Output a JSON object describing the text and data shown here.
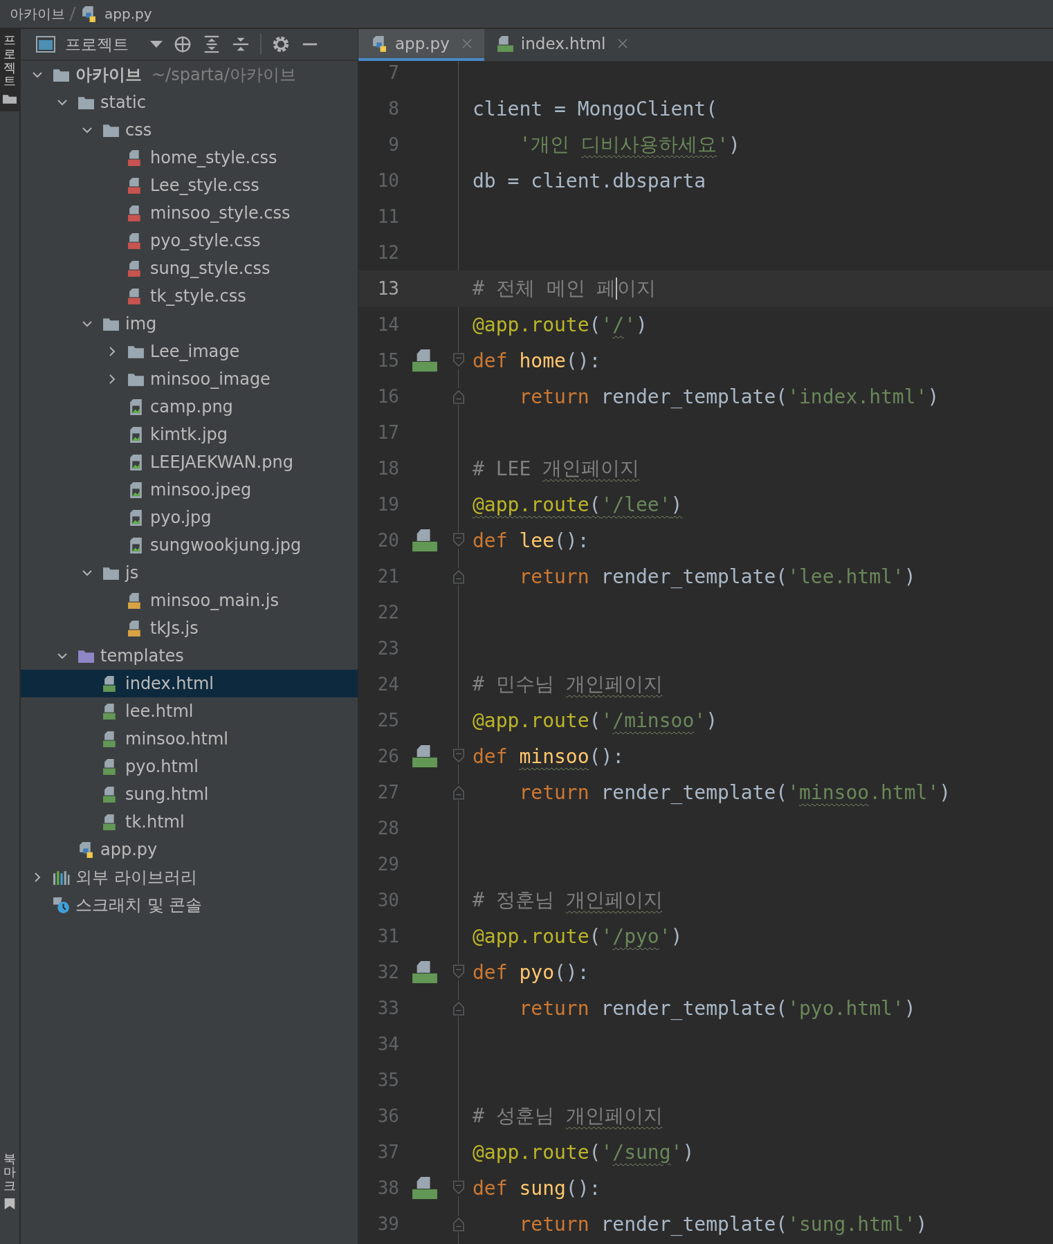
{
  "breadcrumb": [
    "아카이브",
    "app.py"
  ],
  "tool_strip": [
    {
      "label": "프로젝트",
      "selected": true,
      "kind": "project"
    },
    {
      "label": "북마크",
      "selected": false,
      "kind": "bookmarks"
    }
  ],
  "project_panel": {
    "title": "프로젝트",
    "tree": [
      {
        "label": "아카이브",
        "path": "~/sparta/아카이브",
        "kind": "folder",
        "expanded": true,
        "selected": false,
        "children": [
          {
            "label": "static",
            "kind": "folder",
            "expanded": true,
            "selected": false,
            "children": [
              {
                "label": "css",
                "kind": "folder",
                "expanded": true,
                "selected": false,
                "children": [
                  {
                    "label": "home_style.css",
                    "kind": "css",
                    "selected": false
                  },
                  {
                    "label": "Lee_style.css",
                    "kind": "css",
                    "selected": false
                  },
                  {
                    "label": "minsoo_style.css",
                    "kind": "css",
                    "selected": false
                  },
                  {
                    "label": "pyo_style.css",
                    "kind": "css",
                    "selected": false
                  },
                  {
                    "label": "sung_style.css",
                    "kind": "css",
                    "selected": false
                  },
                  {
                    "label": "tk_style.css",
                    "kind": "css",
                    "selected": false
                  }
                ]
              },
              {
                "label": "img",
                "kind": "folder",
                "expanded": true,
                "selected": false,
                "children": [
                  {
                    "label": "Lee_image",
                    "kind": "folder",
                    "expanded": false,
                    "selected": false
                  },
                  {
                    "label": "minsoo_image",
                    "kind": "folder",
                    "expanded": false,
                    "selected": false
                  },
                  {
                    "label": "camp.png",
                    "kind": "image",
                    "selected": false
                  },
                  {
                    "label": "kimtk.jpg",
                    "kind": "image",
                    "selected": false
                  },
                  {
                    "label": "LEEJAEKWAN.png",
                    "kind": "image",
                    "selected": false
                  },
                  {
                    "label": "minsoo.jpeg",
                    "kind": "image",
                    "selected": false
                  },
                  {
                    "label": "pyo.jpg",
                    "kind": "image",
                    "selected": false
                  },
                  {
                    "label": "sungwookjung.jpg",
                    "kind": "image",
                    "selected": false
                  }
                ]
              },
              {
                "label": "js",
                "kind": "folder",
                "expanded": true,
                "selected": false,
                "children": [
                  {
                    "label": "minsoo_main.js",
                    "kind": "js",
                    "selected": false
                  },
                  {
                    "label": "tkJs.js",
                    "kind": "js",
                    "selected": false
                  }
                ]
              }
            ]
          },
          {
            "label": "templates",
            "kind": "templates",
            "expanded": true,
            "selected": false,
            "children": [
              {
                "label": "index.html",
                "kind": "html",
                "selected": true
              },
              {
                "label": "lee.html",
                "kind": "html",
                "selected": false
              },
              {
                "label": "minsoo.html",
                "kind": "html",
                "selected": false
              },
              {
                "label": "pyo.html",
                "kind": "html",
                "selected": false
              },
              {
                "label": "sung.html",
                "kind": "html",
                "selected": false
              },
              {
                "label": "tk.html",
                "kind": "html",
                "selected": false
              }
            ]
          },
          {
            "label": "app.py",
            "kind": "python",
            "selected": false
          }
        ]
      },
      {
        "label": "외부 라이브러리",
        "kind": "library",
        "expanded": false,
        "selected": false
      },
      {
        "label": "스크래치 및 콘솔",
        "kind": "scratch",
        "selected": false
      }
    ]
  },
  "tabs": [
    {
      "label": "app.py",
      "kind": "python",
      "selected": true
    },
    {
      "label": "index.html",
      "kind": "html",
      "selected": false
    }
  ],
  "lines": [
    {
      "number": "7"
    },
    {
      "number": "8",
      "tokens": [
        {
          "text": "client = MongoClient(",
          "kind": "plain"
        }
      ]
    },
    {
      "number": "9",
      "indented": true,
      "tokens": [
        {
          "text": "'개인 ",
          "kind": "string"
        },
        {
          "text": "디비사용하세요",
          "kind": "string",
          "underlined": true
        },
        {
          "text": "'",
          "kind": "string"
        },
        {
          "text": ")",
          "kind": "plain"
        }
      ]
    },
    {
      "number": "10",
      "tokens": [
        {
          "text": "db = client.dbsparta",
          "kind": "plain"
        }
      ]
    },
    {
      "number": "11"
    },
    {
      "number": "12"
    },
    {
      "number": "13",
      "current": true,
      "tokens": [
        {
          "text": "# 전체 메인 페",
          "kind": "comment",
          "caret_after": true
        },
        {
          "text": "이지",
          "kind": "comment"
        }
      ]
    },
    {
      "number": "14",
      "tokens": [
        {
          "text": "@app.route",
          "kind": "decorator"
        },
        {
          "text": "(",
          "kind": "plain"
        },
        {
          "text": "'",
          "kind": "string"
        },
        {
          "text": "/",
          "kind": "string",
          "underlined": true
        },
        {
          "text": "'",
          "kind": "string"
        },
        {
          "text": ")",
          "kind": "plain"
        }
      ]
    },
    {
      "number": "15",
      "html_icon": true,
      "fold_start": true,
      "tokens": [
        {
          "text": "def",
          "kind": "keyword"
        },
        {
          "text": "home",
          "kind": "function",
          "space_before": true
        },
        {
          "text": "():",
          "kind": "plain"
        }
      ]
    },
    {
      "number": "16",
      "indented": true,
      "fold_end": true,
      "tokens": [
        {
          "text": "return",
          "kind": "keyword"
        },
        {
          "text": "render_template(",
          "kind": "plain",
          "space_before": true
        },
        {
          "text": "'index.html'",
          "kind": "string"
        },
        {
          "text": ")",
          "kind": "plain"
        }
      ]
    },
    {
      "number": "17"
    },
    {
      "number": "18",
      "tokens": [
        {
          "text": "# LEE ",
          "kind": "comment"
        },
        {
          "text": "개인페이지",
          "kind": "comment",
          "underlined": true
        }
      ]
    },
    {
      "number": "19",
      "tokens": [
        {
          "text": "@app.route",
          "kind": "decorator",
          "underlined": true
        },
        {
          "text": "(",
          "kind": "plain",
          "underlined": true
        },
        {
          "text": "'/lee'",
          "kind": "string",
          "underlined": true
        },
        {
          "text": ")",
          "kind": "plain",
          "underlined": true
        }
      ]
    },
    {
      "number": "20",
      "html_icon": true,
      "fold_start": true,
      "tokens": [
        {
          "text": "def",
          "kind": "keyword"
        },
        {
          "text": "lee",
          "kind": "function",
          "space_before": true
        },
        {
          "text": "():",
          "kind": "plain"
        }
      ]
    },
    {
      "number": "21",
      "indented": true,
      "fold_end": true,
      "tokens": [
        {
          "text": "return",
          "kind": "keyword"
        },
        {
          "text": "render_template(",
          "kind": "plain",
          "space_before": true
        },
        {
          "text": "'lee.html'",
          "kind": "string"
        },
        {
          "text": ")",
          "kind": "plain"
        }
      ]
    },
    {
      "number": "22"
    },
    {
      "number": "23"
    },
    {
      "number": "24",
      "tokens": [
        {
          "text": "# 민수님 ",
          "kind": "comment"
        },
        {
          "text": "개인페이지",
          "kind": "comment",
          "underlined": true
        }
      ]
    },
    {
      "number": "25",
      "tokens": [
        {
          "text": "@app.route",
          "kind": "decorator"
        },
        {
          "text": "(",
          "kind": "plain"
        },
        {
          "text": "'",
          "kind": "string"
        },
        {
          "text": "/minsoo",
          "kind": "string",
          "underlined": true
        },
        {
          "text": "'",
          "kind": "string"
        },
        {
          "text": ")",
          "kind": "plain"
        }
      ]
    },
    {
      "number": "26",
      "html_icon": true,
      "fold_start": true,
      "tokens": [
        {
          "text": "def",
          "kind": "keyword"
        },
        {
          "text": "minsoo",
          "kind": "function",
          "underlined": true,
          "space_before": true
        },
        {
          "text": "():",
          "kind": "plain"
        }
      ]
    },
    {
      "number": "27",
      "indented": true,
      "fold_end": true,
      "tokens": [
        {
          "text": "return",
          "kind": "keyword"
        },
        {
          "text": "render_template(",
          "kind": "plain",
          "space_before": true
        },
        {
          "text": "'",
          "kind": "string"
        },
        {
          "text": "minsoo",
          "kind": "string",
          "underlined": true
        },
        {
          "text": ".html'",
          "kind": "string"
        },
        {
          "text": ")",
          "kind": "plain"
        }
      ]
    },
    {
      "number": "28"
    },
    {
      "number": "29"
    },
    {
      "number": "30",
      "tokens": [
        {
          "text": "# 정훈님 ",
          "kind": "comment"
        },
        {
          "text": "개인페이지",
          "kind": "comment",
          "underlined": true
        }
      ]
    },
    {
      "number": "31",
      "tokens": [
        {
          "text": "@app.route",
          "kind": "decorator"
        },
        {
          "text": "(",
          "kind": "plain"
        },
        {
          "text": "'",
          "kind": "string"
        },
        {
          "text": "/pyo",
          "kind": "string",
          "underlined": true
        },
        {
          "text": "'",
          "kind": "string"
        },
        {
          "text": ")",
          "kind": "plain"
        }
      ]
    },
    {
      "number": "32",
      "html_icon": true,
      "fold_start": true,
      "tokens": [
        {
          "text": "def",
          "kind": "keyword"
        },
        {
          "text": "pyo",
          "kind": "function",
          "space_before": true
        },
        {
          "text": "():",
          "kind": "plain"
        }
      ]
    },
    {
      "number": "33",
      "indented": true,
      "fold_end": true,
      "tokens": [
        {
          "text": "return",
          "kind": "keyword"
        },
        {
          "text": "render_template(",
          "kind": "plain",
          "space_before": true
        },
        {
          "text": "'pyo.html'",
          "kind": "string"
        },
        {
          "text": ")",
          "kind": "plain"
        }
      ]
    },
    {
      "number": "34"
    },
    {
      "number": "35"
    },
    {
      "number": "36",
      "tokens": [
        {
          "text": "# 성훈님 ",
          "kind": "comment"
        },
        {
          "text": "개인페이지",
          "kind": "comment",
          "underlined": true
        }
      ]
    },
    {
      "number": "37",
      "tokens": [
        {
          "text": "@app.route",
          "kind": "decorator"
        },
        {
          "text": "(",
          "kind": "plain"
        },
        {
          "text": "'",
          "kind": "string"
        },
        {
          "text": "/sung",
          "kind": "string",
          "underlined": true
        },
        {
          "text": "'",
          "kind": "string"
        },
        {
          "text": ")",
          "kind": "plain"
        }
      ]
    },
    {
      "number": "38",
      "html_icon": true,
      "fold_start": true,
      "tokens": [
        {
          "text": "def",
          "kind": "keyword"
        },
        {
          "text": "sung",
          "kind": "function",
          "space_before": true
        },
        {
          "text": "():",
          "kind": "plain"
        }
      ]
    },
    {
      "number": "39",
      "indented": true,
      "fold_end": true,
      "tokens": [
        {
          "text": "return",
          "kind": "keyword"
        },
        {
          "text": "render_template(",
          "kind": "plain",
          "space_before": true
        },
        {
          "text": "'sung.html'",
          "kind": "string"
        },
        {
          "text": ")",
          "kind": "plain"
        }
      ]
    }
  ]
}
